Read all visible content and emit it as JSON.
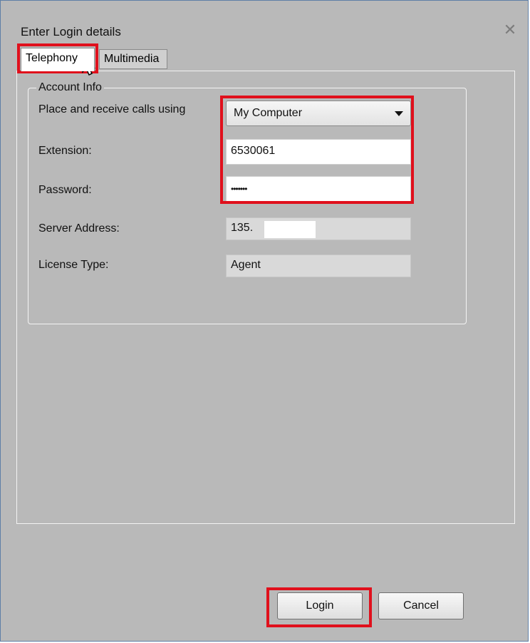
{
  "dialog": {
    "title": "Enter Login details",
    "close_icon": "close-icon"
  },
  "tabs": [
    {
      "label": "Telephony",
      "active": true
    },
    {
      "label": "Multimedia",
      "active": false
    }
  ],
  "account_info": {
    "group_label": "Account Info",
    "place_calls_label": "Place and receive calls using",
    "place_calls_value": "My Computer",
    "extension_label": "Extension:",
    "extension_value": "6530061",
    "password_label": "Password:",
    "password_value": "•••••••",
    "server_address_label": "Server Address:",
    "server_address_value": "135.",
    "license_type_label": "License Type:",
    "license_type_value": "Agent"
  },
  "buttons": {
    "login": "Login",
    "cancel": "Cancel"
  },
  "colors": {
    "highlight": "#e0101c",
    "dialog_bg": "#b9b9b9"
  }
}
